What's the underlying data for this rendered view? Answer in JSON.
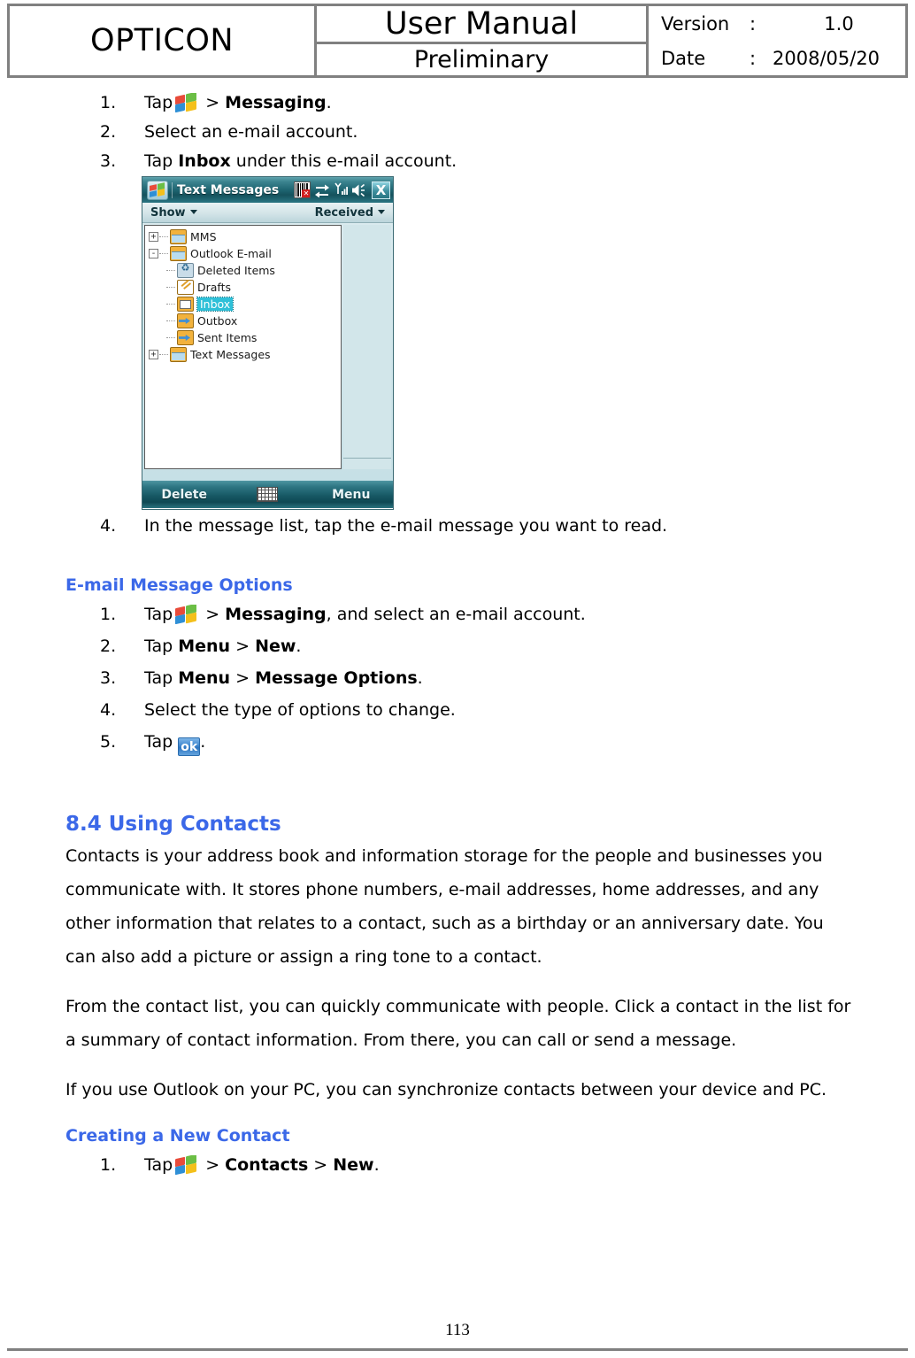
{
  "header": {
    "brand": "OPTICON",
    "title": "User Manual",
    "subtitle": "Preliminary",
    "version_label": "Version",
    "version_colon": ":",
    "version_value": "1.0",
    "date_label": "Date",
    "date_colon": ":",
    "date_value": "2008/05/20"
  },
  "reading_steps": {
    "items": [
      {
        "num": "1.",
        "pre": "Tap",
        "icon": "windows-flag-icon",
        "mid": " > ",
        "bold1": "Messaging",
        "post": "."
      },
      {
        "num": "2.",
        "text": "Select an e-mail account."
      },
      {
        "num": "3.",
        "pre": "Tap ",
        "bold1": "Inbox",
        "post": " under this e-mail account."
      },
      {
        "num": "4.",
        "text": "In the message list, tap the e-mail message you want to read."
      }
    ]
  },
  "device": {
    "title": "Text Messages",
    "status_icons": [
      "barcode-disabled-icon",
      "connectivity-icon",
      "signal-strength-icon",
      "speaker-icon"
    ],
    "close_label": "X",
    "menubar": {
      "left": "Show",
      "right": "Received"
    },
    "tree": [
      {
        "label": "MMS",
        "level": 0,
        "expander": "+",
        "icon": "mailbox-folder-icon",
        "selected": false
      },
      {
        "label": "Outlook E-mail",
        "level": 0,
        "expander": "-",
        "icon": "mailbox-folder-icon",
        "selected": false
      },
      {
        "label": "Deleted Items",
        "level": 1,
        "expander": "",
        "icon": "deleted-items-icon",
        "selected": false
      },
      {
        "label": "Drafts",
        "level": 1,
        "expander": "",
        "icon": "drafts-icon",
        "selected": false
      },
      {
        "label": "Inbox",
        "level": 1,
        "expander": "",
        "icon": "inbox-icon",
        "selected": true
      },
      {
        "label": "Outbox",
        "level": 1,
        "expander": "",
        "icon": "outbox-icon",
        "selected": false
      },
      {
        "label": "Sent Items",
        "level": 1,
        "expander": "",
        "icon": "sent-items-icon",
        "selected": false
      },
      {
        "label": "Text Messages",
        "level": 0,
        "expander": "+",
        "icon": "mailbox-folder-icon",
        "selected": false
      }
    ],
    "softkeys": {
      "left": "Delete",
      "center_icon": "keyboard-icon",
      "right": "Menu"
    }
  },
  "email_options": {
    "heading": "E-mail Message Options",
    "items": [
      {
        "num": "1.",
        "pre": "Tap",
        "icon": "windows-flag-icon",
        "mid": " > ",
        "bold1": "Messaging",
        "post": ", and select an e-mail account."
      },
      {
        "num": "2.",
        "pre": "Tap ",
        "bold1": "Menu",
        "mid": " > ",
        "bold2": "New",
        "post": "."
      },
      {
        "num": "3.",
        "pre": "Tap ",
        "bold1": "Menu",
        "mid": " > ",
        "bold2": "Message Options",
        "post": "."
      },
      {
        "num": "4.",
        "text": "Select the type of options to change."
      },
      {
        "num": "5.",
        "pre": "Tap ",
        "icon": "ok-button-icon",
        "post": "."
      }
    ]
  },
  "contacts_section": {
    "heading": "8.4 Using Contacts",
    "paragraphs": [
      "Contacts is your address book and information storage for the people and businesses you communicate with. It stores phone numbers, e-mail addresses, home addresses, and any other information that relates to a contact, such as a birthday or an anniversary date. You can also add a picture or assign a ring tone to a contact.",
      "From the contact list, you can quickly communicate with people. Click a contact in the list for a summary of contact information. From there, you can call or send a message.",
      "If you use Outlook on your PC, you can synchronize contacts between your device and PC."
    ],
    "subheading": "Creating a New Contact",
    "items": [
      {
        "num": "1.",
        "pre": "Tap",
        "icon": "windows-flag-icon",
        "mid": " > ",
        "bold1": "Contacts",
        "mid2": " > ",
        "bold2": "New",
        "post": "."
      }
    ]
  },
  "footer": {
    "page_number": "113"
  },
  "colors": {
    "heading_blue": "#3B68E8",
    "rule_gray": "#808080",
    "device_titlebar_teal": "#1E6571",
    "selection_cyan": "#2FC0D8"
  }
}
